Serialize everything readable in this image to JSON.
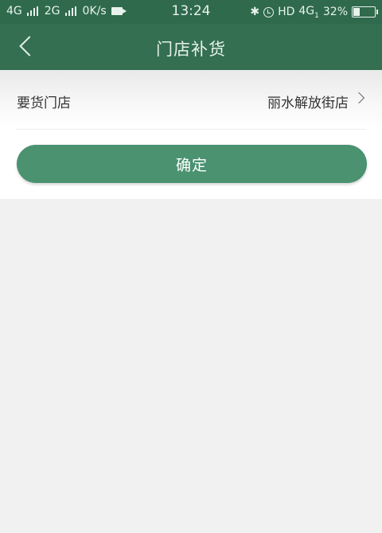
{
  "status_bar": {
    "network1": "4G",
    "network2": "2G",
    "speed": "0K/s",
    "time": "13:24",
    "hd": "HD",
    "network3": "4G",
    "network3_sub": "1",
    "battery": "32%",
    "battery_level": 0.32
  },
  "header": {
    "title": "门店补货"
  },
  "form": {
    "store_label": "要货门店",
    "store_value": "丽水解放街店"
  },
  "actions": {
    "confirm_label": "确定"
  },
  "colors": {
    "status_bar": "#2f6a4c",
    "header": "#336f50",
    "accent": "#4a9270",
    "background": "#f1f1f1"
  },
  "icons": {
    "back": "chevron-left-icon",
    "row_arrow": "chevron-right-icon",
    "bluetooth": "bluetooth-icon",
    "alarm": "alarm-icon",
    "camera": "video-camera-icon",
    "battery": "battery-icon"
  }
}
